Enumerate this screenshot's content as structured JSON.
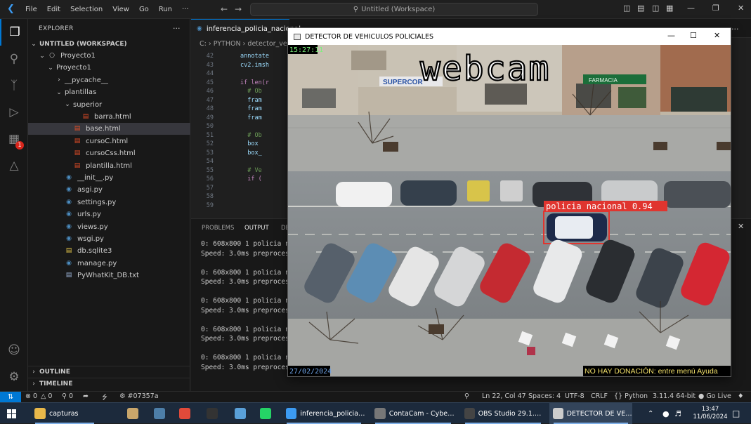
{
  "titlebar": {
    "menus": [
      "File",
      "Edit",
      "Selection",
      "View",
      "Go",
      "Run",
      "···"
    ],
    "search": "Untitled (Workspace)"
  },
  "activity": {
    "extensions_badge": "1"
  },
  "explorer": {
    "header": "EXPLORER",
    "workspace": "UNTITLED (WORKSPACE)",
    "items": [
      {
        "label": "Proyecto1",
        "type": "folder-root"
      },
      {
        "label": "Proyecto1",
        "type": "folder"
      },
      {
        "label": "__pycache__",
        "type": "folder"
      },
      {
        "label": "plantillas",
        "type": "folder"
      },
      {
        "label": "superior",
        "type": "folder"
      },
      {
        "label": "barra.html",
        "type": "html"
      },
      {
        "label": "base.html",
        "type": "html"
      },
      {
        "label": "cursoC.html",
        "type": "html"
      },
      {
        "label": "cursoCss.html",
        "type": "html"
      },
      {
        "label": "plantilla.html",
        "type": "html"
      },
      {
        "label": "__init__.py",
        "type": "py"
      },
      {
        "label": "asgi.py",
        "type": "py"
      },
      {
        "label": "settings.py",
        "type": "py"
      },
      {
        "label": "urls.py",
        "type": "py"
      },
      {
        "label": "views.py",
        "type": "py"
      },
      {
        "label": "wsgi.py",
        "type": "py"
      },
      {
        "label": "db.sqlite3",
        "type": "db"
      },
      {
        "label": "manage.py",
        "type": "py"
      },
      {
        "label": "PyWhatKit_DB.txt",
        "type": "txt"
      }
    ],
    "outline": "OUTLINE",
    "timeline": "TIMELINE"
  },
  "editor": {
    "tab": "inferencia_policia_nacional",
    "breadcrumb": [
      "C:",
      "PYTHON",
      "detector_ve"
    ],
    "line_numbers": [
      "42",
      "43",
      "44",
      "45",
      "46",
      "47",
      "48",
      "49",
      "50",
      "51",
      "52",
      "53",
      "54",
      "55",
      "56",
      "57",
      "58",
      "59"
    ],
    "code_lines": [
      "annotate",
      "cv2.imsh",
      "",
      "if len(r",
      "  # Ob",
      "  fram",
      "  fram",
      "  fram",
      "",
      "  # Ob",
      "  box",
      "  box_",
      "",
      "  # Ve",
      "  if (",
      "",
      "",
      ""
    ]
  },
  "panel": {
    "tabs": [
      "PROBLEMS",
      "OUTPUT",
      "DE"
    ],
    "output": [
      "0: 608x800 1 policia n",
      "Speed: 3.0ms preproces",
      "",
      "0: 608x800 1 policia n",
      "Speed: 3.0ms preproces",
      "",
      "0: 608x800 1 policia n",
      "Speed: 3.0ms preproces",
      "",
      "0: 608x800 1 policia n",
      "Speed: 3.0ms preproces",
      "",
      "0: 608x800 1 policia n",
      "Speed: 3.0ms preproces"
    ]
  },
  "cv_window": {
    "title": "DETECTOR DE VEHICULOS POLICIALES",
    "overlay_time": "15:27:11",
    "overlay_label": "webcam",
    "overlay_date": "27/02/2024",
    "overlay_notice": "NO HAY DONACIÓN: entre menú Ayuda",
    "shop_sign": "SUPERCOR",
    "pharmacy_sign": "FARMACIA",
    "detection_label": "policia nacional 0.94"
  },
  "statusbar": {
    "errors": "0",
    "warnings": "0",
    "ports": "0",
    "commit": "#07357a",
    "position": "Ln 22, Col 47",
    "spaces": "Spaces: 4",
    "encoding": "UTF-8",
    "eol": "CRLF",
    "language": "Python",
    "interpreter": "3.11.4 64-bit",
    "golive": "Go Live"
  },
  "taskbar": {
    "apps": [
      {
        "label": "capturas",
        "icon": "folder-icon",
        "color": "#e8b84a"
      },
      {
        "label": "",
        "icon": "python-idle-icon",
        "color": "#c9a66b"
      },
      {
        "label": "",
        "icon": "calculator-icon",
        "color": "#4d7ea8"
      },
      {
        "label": "",
        "icon": "chrome-icon",
        "color": "#e04a3a"
      },
      {
        "label": "",
        "icon": "terminal-icon",
        "color": "#333333"
      },
      {
        "label": "",
        "icon": "notebook-icon",
        "color": "#5aa0d8"
      },
      {
        "label": "",
        "icon": "whatsapp-icon",
        "color": "#25d366"
      },
      {
        "label": "inferencia_policia_...",
        "icon": "vscode-icon",
        "color": "#3c9bf2"
      },
      {
        "label": "ContaCam - Cyber...",
        "icon": "contacam-icon",
        "color": "#777777"
      },
      {
        "label": "OBS Studio 29.1.3 - ...",
        "icon": "obs-icon",
        "color": "#444444"
      },
      {
        "label": "DETECTOR DE VEHI...",
        "icon": "opencv-window-icon",
        "color": "#cccccc"
      }
    ],
    "time": "13:47",
    "date": "11/06/2024"
  }
}
